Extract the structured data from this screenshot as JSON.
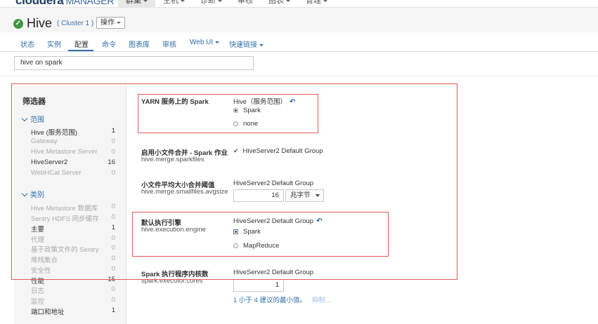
{
  "topnav": {
    "brand": "cloudera",
    "brand_sub": "MANAGER",
    "menu": [
      "群集",
      "主机",
      "诊断",
      "审核",
      "图表",
      "管理"
    ]
  },
  "service": {
    "name": "Hive",
    "cluster": "( Cluster 1 )",
    "actions_label": "操作"
  },
  "tabs": [
    "状态",
    "实例",
    "配置",
    "命令",
    "图表库",
    "审核",
    "Web UI",
    "快速链接"
  ],
  "search": {
    "value": "hive on spark"
  },
  "filter": {
    "title": "筛选器",
    "scope_title": "范围",
    "scope_items": [
      {
        "label": "Hive (服务范围)",
        "count": "1",
        "active": true
      },
      {
        "label": "Gateway",
        "count": "0",
        "active": false
      },
      {
        "label": "Hive Metastore Server",
        "count": "0",
        "active": false
      },
      {
        "label": "HiveServer2",
        "count": "16",
        "active": true
      },
      {
        "label": "WebHCat Server",
        "count": "0",
        "active": false
      }
    ],
    "category_title": "类别",
    "category_items": [
      {
        "label": "Hive Metastore 数据库",
        "count": "0",
        "active": false
      },
      {
        "label": "Sentry HDFS 同步缓存",
        "count": "0",
        "active": false
      },
      {
        "label": "主要",
        "count": "1",
        "active": true
      },
      {
        "label": "代理",
        "count": "0",
        "active": false
      },
      {
        "label": "基于政策文件的 Sentry",
        "count": "0",
        "active": false
      },
      {
        "label": "堆栈集合",
        "count": "0",
        "active": false
      },
      {
        "label": "安全性",
        "count": "0",
        "active": false
      },
      {
        "label": "性能",
        "count": "15",
        "active": true
      },
      {
        "label": "日志",
        "count": "0",
        "active": false
      },
      {
        "label": "监控",
        "count": "0",
        "active": false
      },
      {
        "label": "端口和地址",
        "count": "1",
        "active": true
      }
    ]
  },
  "props": {
    "p1": {
      "name": "YARN 服务上的 Spark",
      "scope": "Hive（服务范围）",
      "options": [
        "Spark",
        "none"
      ]
    },
    "p2": {
      "name": "启用小文件合并 - Spark 作业",
      "key": "hive.merge.sparkfiles",
      "scope": "HiveServer2 Default Group"
    },
    "p3": {
      "name": "小文件平均大小合并阈值",
      "key": "hive.merge.smallfiles.avgsize",
      "scope": "HiveServer2 Default Group",
      "value": "16",
      "unit": "兆字节"
    },
    "p4": {
      "name": "默认执行引擎",
      "key": "hive.execution.engine",
      "scope": "HiveServer2 Default Group",
      "options": [
        "Spark",
        "MapReduce"
      ]
    },
    "p5": {
      "name": "Spark 执行程序内核数",
      "key": "spark.executor.cores",
      "scope": "HiveServer2 Default Group",
      "value": "1",
      "hint": "1 小于 4 建议的最小值。",
      "suppress": "抑制..."
    }
  },
  "colors": {
    "link": "#2f6ea8",
    "highlight_box": "#e05a5a",
    "ok": "#3f9a3f"
  }
}
